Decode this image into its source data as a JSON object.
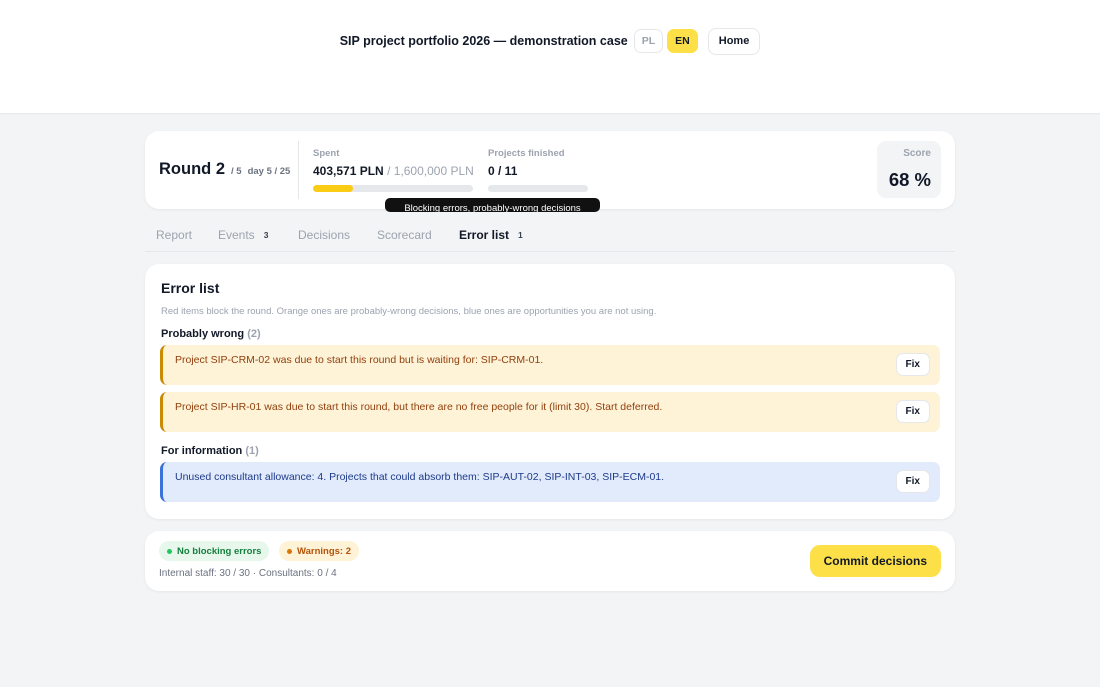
{
  "header": {
    "title": "SIP project portfolio 2026 — demonstration case",
    "lang_pl": "PL",
    "lang_en": "EN",
    "home_label": "Home"
  },
  "status": {
    "round_label": "Round 2",
    "round_total": "/ 5",
    "day": "day 5 / 25",
    "spent_label": "Spent",
    "spent_value": "403,571 PLN",
    "spent_budget": "/ 1,600,000 PLN",
    "spent_fraction": 0.252,
    "finished_label": "Projects finished",
    "finished_value": "0 / 11",
    "finished_fraction": 0,
    "score_label": "Score",
    "score_value": "68 %"
  },
  "tooltip": {
    "text": "Blocking errors, probably-wrong decisions"
  },
  "tabs": [
    {
      "label": "Report",
      "badge": ""
    },
    {
      "label": "Events",
      "badge": "3"
    },
    {
      "label": "Decisions",
      "badge": ""
    },
    {
      "label": "Scorecard",
      "badge": ""
    },
    {
      "label": "Error list",
      "badge": "1"
    }
  ],
  "errors": {
    "title": "Error list",
    "description": "Red items block the round. Orange ones are probably-wrong decisions, blue ones are opportunities you are not using.",
    "fix_label": "Fix",
    "warn_section": {
      "label": "Probably wrong",
      "count": "(2)",
      "items": [
        "Project SIP-CRM-02 was due to start this round but is waiting for: SIP-CRM-01.",
        "Project SIP-HR-01 was due to start this round, but there are no free people for it (limit 30). Start deferred."
      ]
    },
    "info_section": {
      "label": "For information",
      "count": "(1)",
      "items": [
        "Unused consultant allowance: 4. Projects that could absorb them: SIP-AUT-02, SIP-INT-03, SIP-ECM-01."
      ]
    }
  },
  "footer": {
    "no_blocking": "No blocking errors",
    "warnings": "Warnings: 2",
    "staff_line": "Internal staff: 30 / 30 · Consultants: 0 / 4",
    "commit_label": "Commit decisions"
  }
}
